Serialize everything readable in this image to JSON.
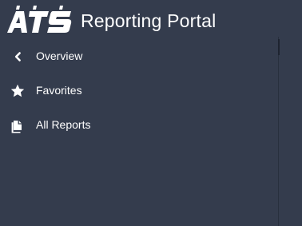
{
  "header": {
    "logo_text": "ATS",
    "title": "Reporting Portal"
  },
  "nav": {
    "items": [
      {
        "icon": "chevron-left-icon",
        "label": "Overview"
      },
      {
        "icon": "star-icon",
        "label": "Favorites"
      },
      {
        "icon": "copy-documents-icon",
        "label": "All Reports"
      }
    ]
  },
  "colors": {
    "background": "#343c4d",
    "text": "#ffffff",
    "divider": "#28303e"
  }
}
